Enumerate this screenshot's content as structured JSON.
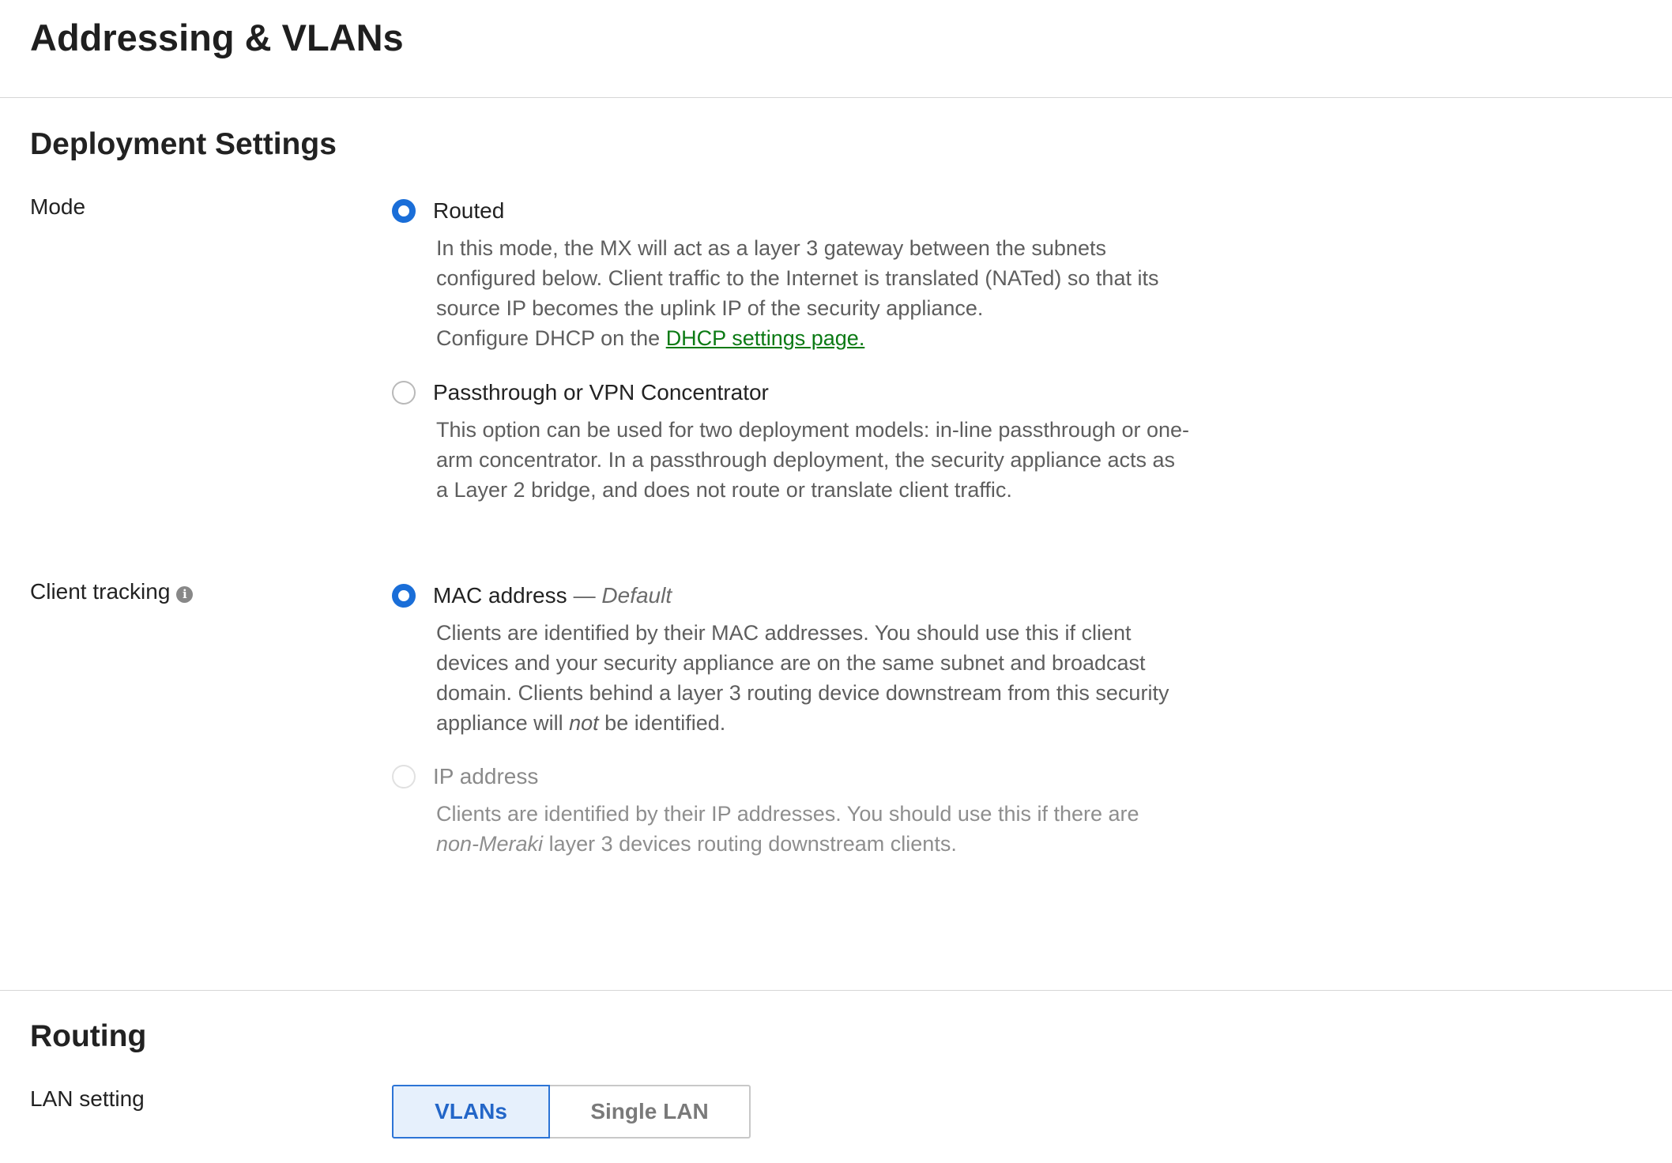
{
  "page": {
    "title": "Addressing & VLANs"
  },
  "deployment": {
    "section_title": "Deployment Settings",
    "mode": {
      "label": "Mode",
      "options": [
        {
          "label": "Routed",
          "selected": true,
          "desc_text": "In this mode, the MX will act as a layer 3 gateway between the subnets configured below. Client traffic to the Internet is translated (NATed) so that its source IP becomes the uplink IP of the security appliance.",
          "desc_prefix": "Configure DHCP on the",
          "link_text": "DHCP settings page."
        },
        {
          "label": "Passthrough or VPN Concentrator",
          "selected": false,
          "desc_text": "This option can be used for two deployment models: in-line passthrough or one-arm concentrator. In a passthrough deployment, the security appliance acts as a Layer 2 bridge, and does not route or translate client traffic."
        }
      ]
    },
    "client_tracking": {
      "label": "Client tracking",
      "info_icon": "info-icon",
      "options": [
        {
          "label": "MAC address",
          "suffix_dash": "—",
          "suffix_default": "Default",
          "selected": true,
          "desc_before": "Clients are identified by their MAC addresses. You should use this if client devices and your security appliance are on the same subnet and broadcast domain. Clients behind a layer 3 routing device downstream from this security appliance will",
          "desc_em": "not",
          "desc_after": "be identified."
        },
        {
          "label": "IP address",
          "selected": false,
          "disabled": true,
          "desc_before": "Clients are identified by their IP addresses. You should use this if there are",
          "desc_em": "non-Meraki",
          "desc_after": "layer 3 devices routing downstream clients."
        }
      ]
    }
  },
  "routing": {
    "section_title": "Routing",
    "lan_setting": {
      "label": "LAN setting",
      "options": [
        "VLANs",
        "Single LAN"
      ],
      "selected": "VLANs"
    }
  },
  "colors": {
    "accent": "#1a6ed8",
    "link": "#0b7a14",
    "segment_active_bg": "#e6f0fc"
  }
}
